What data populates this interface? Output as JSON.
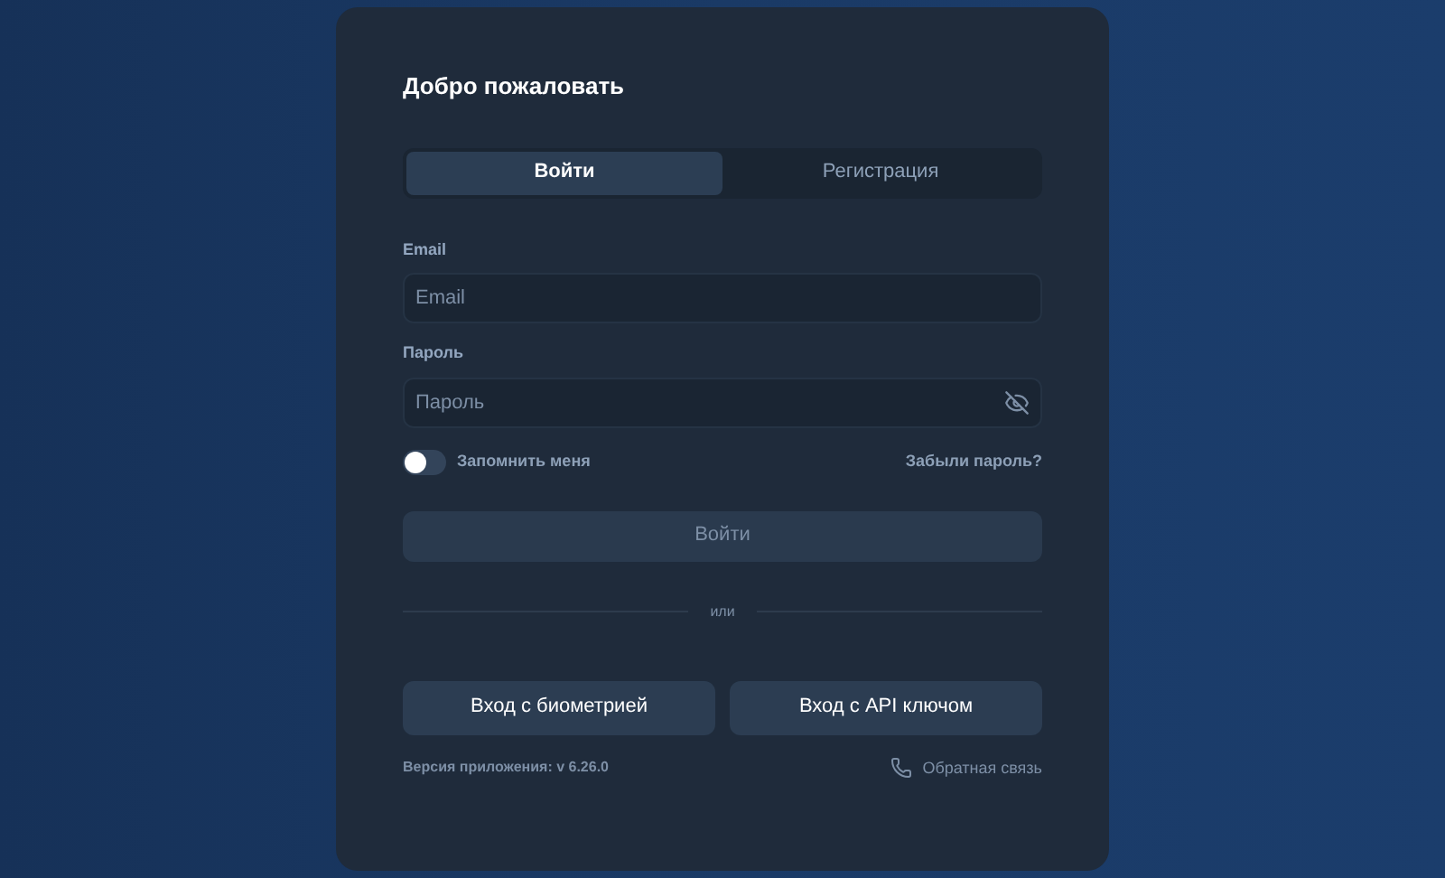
{
  "title": "Добро пожаловать",
  "tabs": [
    {
      "label": "Войти",
      "selected": true
    },
    {
      "label": "Регистрация",
      "selected": false
    }
  ],
  "email": {
    "label": "Email",
    "placeholder": "Email"
  },
  "password": {
    "label": "Пароль",
    "placeholder": "Пароль"
  },
  "remember": {
    "label": "Запомнить меня",
    "on": false
  },
  "forgot_link": "Забыли пароль?",
  "submit": {
    "label": "Войти",
    "disabled": true
  },
  "divider_text": "или",
  "alt_buttons": [
    "Вход с биометрией",
    "Вход с API ключом"
  ],
  "version": "Версия приложения: v 6.26.0",
  "feedback_link": "Обратная связь"
}
